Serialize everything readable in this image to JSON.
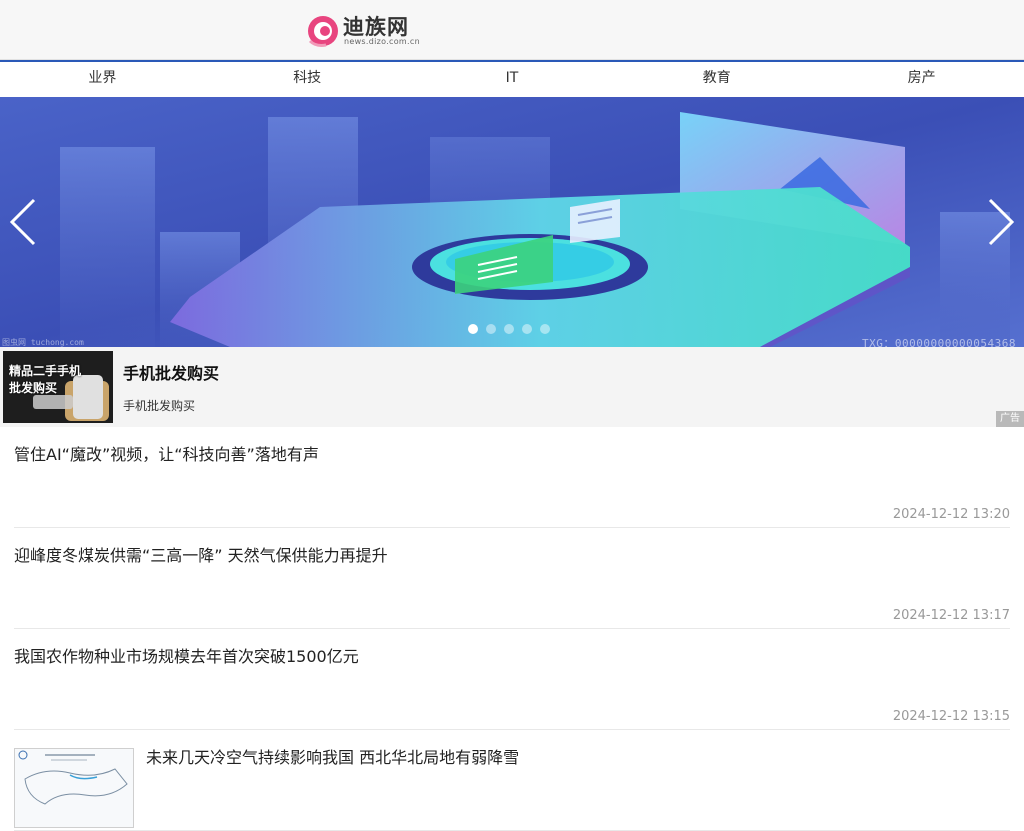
{
  "header": {
    "logo_name": "迪族网",
    "logo_domain": "news.dizo.com.cn"
  },
  "nav": {
    "items": [
      "业界",
      "科技",
      "IT",
      "教育",
      "房产"
    ]
  },
  "banner": {
    "watermark_left": "图虫网 tuchong.com",
    "watermark_right": "TXG：00000000000054368",
    "slide_count": 5,
    "active_index": 0
  },
  "ad": {
    "thumb_text_line1": "精品二手手机",
    "thumb_text_line2": "批发购买",
    "title": "手机批发购买",
    "description": "手机批发购买",
    "badge": "广告"
  },
  "news": [
    {
      "title": "管住AI“魔改”视频，让“科技向善”落地有声",
      "time": "2024-12-12 13:20"
    },
    {
      "title": "迎峰度冬煤炭供需“三高一降” 天然气保供能力再提升",
      "time": "2024-12-12 13:17"
    },
    {
      "title": "我国农作物种业市场规模去年首次突破1500亿元",
      "time": "2024-12-12 13:15"
    },
    {
      "title": "未来几天冷空气持续影响我国 西北华北局地有弱降雪",
      "time": ""
    }
  ],
  "colors": {
    "nav_accent": "#2a59b8",
    "logo_pink": "#e8457f",
    "banner_bg": "#3a4fb8"
  }
}
